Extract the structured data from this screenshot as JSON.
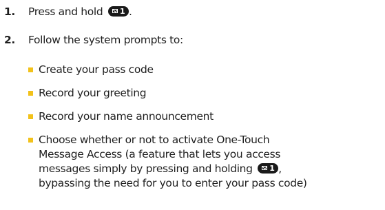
{
  "steps": [
    {
      "number": "1.",
      "text": "Press and hold",
      "suffix": "."
    },
    {
      "number": "2.",
      "text": "Follow the system prompts to:"
    }
  ],
  "key_icon": {
    "name": "voicemail-key-1",
    "digit": "1"
  },
  "bullets": [
    "Create your pass code",
    "Record your greeting",
    "Record your name announcement"
  ],
  "last_bullet": {
    "line1": "Choose whether or not to activate One-Touch",
    "line2": "Message Access (a feature that lets you access",
    "line3_before": "messages simply by pressing and holding",
    "line3_after": ",",
    "line4": "bypassing the need for you to enter your pass code)"
  },
  "colors": {
    "bullet": "#f2c21b",
    "text": "#1f1f1f",
    "key": "#1a1a1a"
  }
}
